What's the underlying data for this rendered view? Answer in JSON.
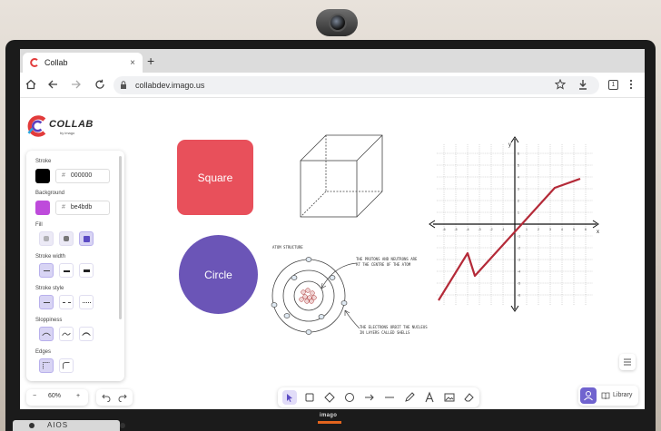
{
  "browser": {
    "tab_title": "Collab",
    "tab_close": "×",
    "new_tab": "+",
    "url": "collabdev.imago.us",
    "tab_count": "1"
  },
  "app": {
    "logo_text": "COLLAB",
    "logo_sub": "by imago",
    "panel": {
      "stroke_label": "Stroke",
      "stroke_color": "#000000",
      "stroke_hex": "000000",
      "background_label": "Background",
      "background_color": "#be4bdb",
      "background_hex": "be4bdb",
      "fill_label": "Fill",
      "stroke_width_label": "Stroke width",
      "stroke_style_label": "Stroke style",
      "sloppiness_label": "Sloppiness",
      "edges_label": "Edges"
    },
    "zoom": {
      "minus": "−",
      "value": "60%",
      "plus": "+"
    },
    "library_label": "Library"
  },
  "canvas": {
    "square_label": "Square",
    "square_color": "#e8505b",
    "circle_label": "Circle",
    "circle_color": "#6b55b7",
    "atom_title": "ATOM STRUCTURE",
    "atom_note1_line1": "THE PROTONS AND NEUTRONS ARE",
    "atom_note1_line2": "AT THE CENTRE OF THE ATOM",
    "atom_note2_line1": "THE ELECTRONS ORBIT THE NUCLEUS",
    "atom_note2_line2": "IN LAYERS CALLED SHELLS",
    "graph_x_label": "x",
    "graph_y_label": "y"
  },
  "brand": "imago",
  "stand_text": "AIOS"
}
